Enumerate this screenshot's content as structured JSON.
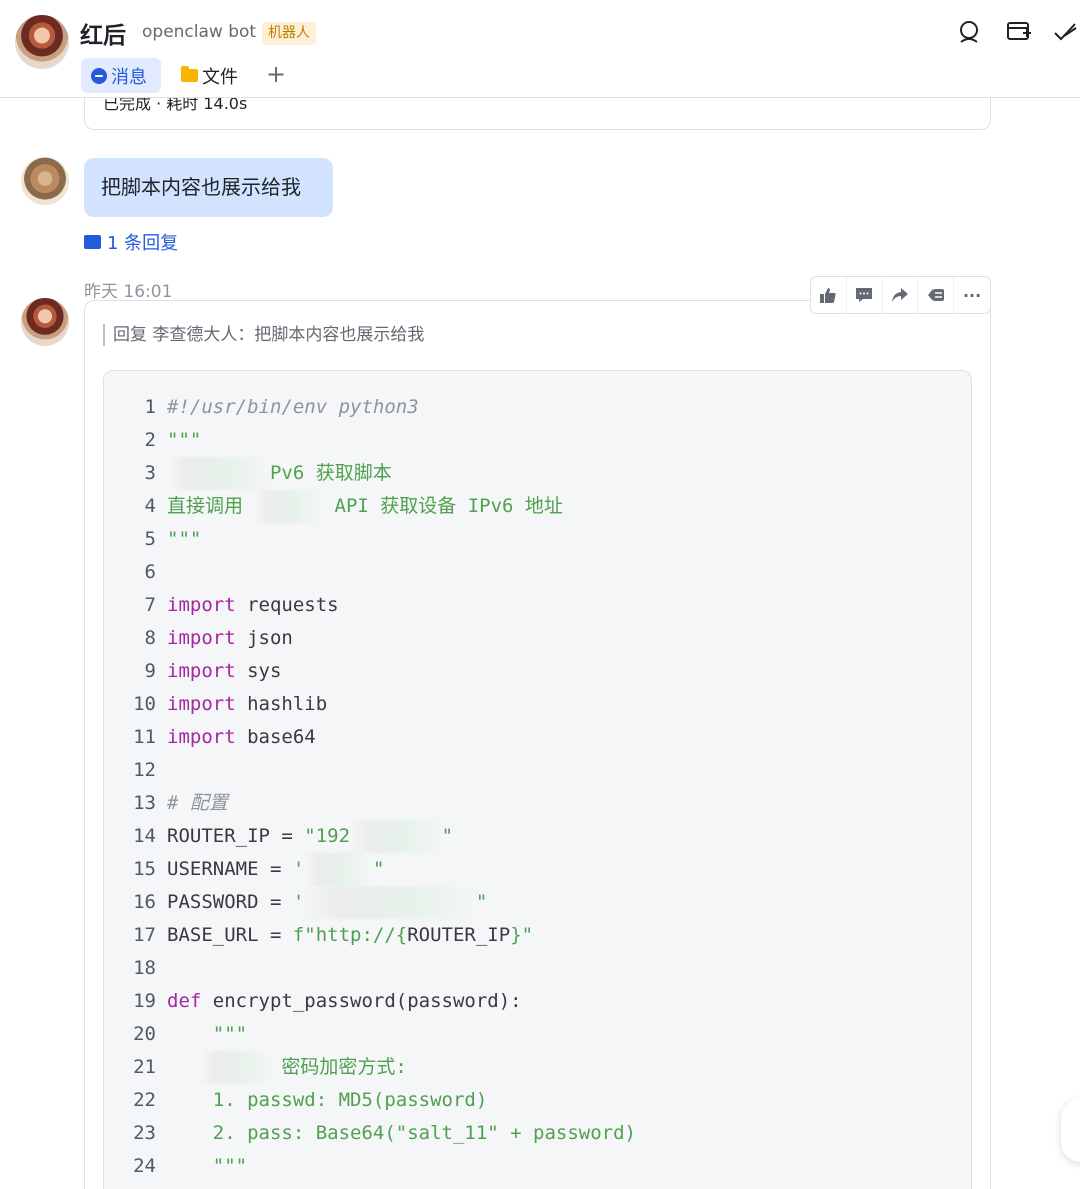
{
  "header": {
    "title": "红后",
    "subtitle": "openclaw bot",
    "badge": "机器人",
    "tabs": [
      {
        "label": "消息",
        "active": true
      },
      {
        "label": "文件",
        "active": false
      }
    ],
    "add_tab": "+",
    "icons": [
      "search-icon",
      "add-to-board-icon",
      "check-all-icon"
    ]
  },
  "prev_message": {
    "partial_text": "已完成 · 耗时 14.0s"
  },
  "message1": {
    "text": "把脚本内容也展示给我",
    "reply_count": "1 条回复"
  },
  "message2": {
    "timestamp": "昨天 16:01",
    "quote": "回复 李查德大人：把脚本内容也展示给我",
    "toolbar": [
      "thumbs-up-icon",
      "comment-icon",
      "forward-icon",
      "reply-icon",
      "more-icon"
    ],
    "more_label": "···"
  },
  "code": {
    "lines": [
      {
        "n": "1",
        "segments": [
          {
            "t": "#!/usr/bin/env python3",
            "c": "cmt"
          }
        ]
      },
      {
        "n": "2",
        "segments": [
          {
            "t": "\"\"\"",
            "c": "str"
          }
        ]
      },
      {
        "n": "3",
        "segments": [
          {
            "t": "         ",
            "c": "blur"
          },
          {
            "t": "Pv6 获取脚本",
            "c": "str"
          }
        ]
      },
      {
        "n": "4",
        "segments": [
          {
            "t": "直接调用 ",
            "c": "str"
          },
          {
            "t": "      ",
            "c": "blur"
          },
          {
            "t": " API 获取设备 IPv6 地址",
            "c": "str"
          }
        ]
      },
      {
        "n": "5",
        "segments": [
          {
            "t": "\"\"\"",
            "c": "str"
          }
        ]
      },
      {
        "n": "6",
        "segments": []
      },
      {
        "n": "7",
        "segments": [
          {
            "t": "import",
            "c": "kw"
          },
          {
            "t": " requests",
            "c": "plain"
          }
        ]
      },
      {
        "n": "8",
        "segments": [
          {
            "t": "import",
            "c": "kw"
          },
          {
            "t": " json",
            "c": "plain"
          }
        ]
      },
      {
        "n": "9",
        "segments": [
          {
            "t": "import",
            "c": "kw"
          },
          {
            "t": " sys",
            "c": "plain"
          }
        ]
      },
      {
        "n": "10",
        "segments": [
          {
            "t": "import",
            "c": "kw"
          },
          {
            "t": " hashlib",
            "c": "plain"
          }
        ]
      },
      {
        "n": "11",
        "segments": [
          {
            "t": "import",
            "c": "kw"
          },
          {
            "t": " base64",
            "c": "plain"
          }
        ]
      },
      {
        "n": "12",
        "segments": []
      },
      {
        "n": "13",
        "segments": [
          {
            "t": "# 配置",
            "c": "cmt"
          }
        ]
      },
      {
        "n": "14",
        "segments": [
          {
            "t": "ROUTER_IP = ",
            "c": "plain"
          },
          {
            "t": "\"192",
            "c": "str"
          },
          {
            "t": "        ",
            "c": "blur"
          },
          {
            "t": "\"",
            "c": "str"
          }
        ]
      },
      {
        "n": "15",
        "segments": [
          {
            "t": "USERNAME = ",
            "c": "plain"
          },
          {
            "t": "'",
            "c": "str"
          },
          {
            "t": "      ",
            "c": "blur"
          },
          {
            "t": "\"",
            "c": "str"
          }
        ]
      },
      {
        "n": "16",
        "segments": [
          {
            "t": "PASSWORD = ",
            "c": "plain"
          },
          {
            "t": "'",
            "c": "str"
          },
          {
            "t": "               ",
            "c": "blur"
          },
          {
            "t": "\"",
            "c": "str"
          }
        ]
      },
      {
        "n": "17",
        "segments": [
          {
            "t": "BASE_URL = ",
            "c": "plain"
          },
          {
            "t": "f\"http://{",
            "c": "str"
          },
          {
            "t": "ROUTER_IP",
            "c": "plain"
          },
          {
            "t": "}\"",
            "c": "str"
          }
        ]
      },
      {
        "n": "18",
        "segments": []
      },
      {
        "n": "19",
        "segments": [
          {
            "t": "def",
            "c": "kw"
          },
          {
            "t": " encrypt_password(password):",
            "c": "plain"
          }
        ]
      },
      {
        "n": "20",
        "segments": [
          {
            "t": "    \"\"\"",
            "c": "str"
          }
        ]
      },
      {
        "n": "21",
        "segments": [
          {
            "t": "   ",
            "c": "plain"
          },
          {
            "t": "      ",
            "c": "blur"
          },
          {
            "t": " 密码加密方式:",
            "c": "str"
          }
        ]
      },
      {
        "n": "22",
        "segments": [
          {
            "t": "    1. passwd: MD5(password)",
            "c": "str"
          }
        ]
      },
      {
        "n": "23",
        "segments": [
          {
            "t": "    2. pass: Base64(\"salt_11\" + password)",
            "c": "str"
          }
        ]
      },
      {
        "n": "24",
        "segments": [
          {
            "t": "    \"\"\"",
            "c": "str"
          }
        ]
      }
    ]
  }
}
